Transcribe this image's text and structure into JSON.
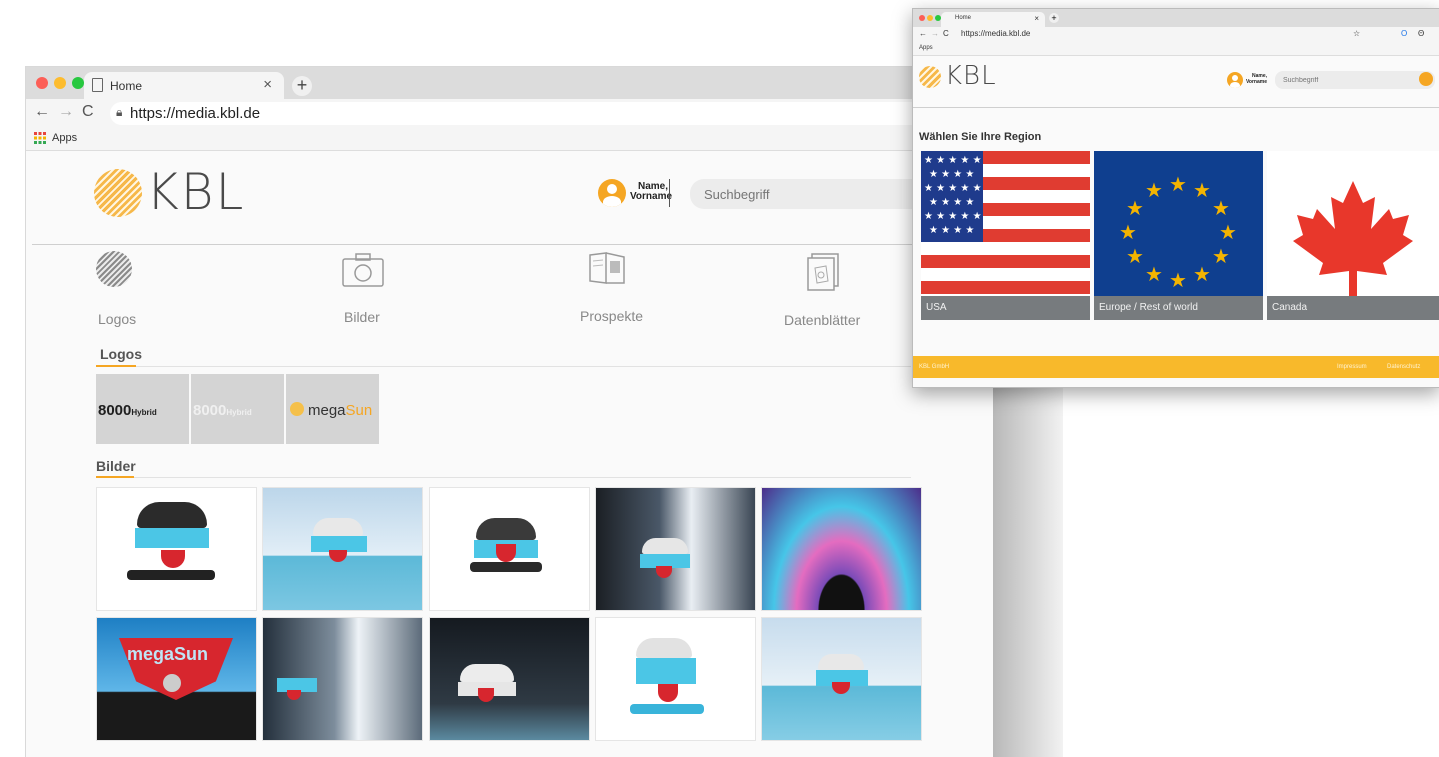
{
  "browser_main": {
    "tab_title": "Home",
    "new_tab": "+",
    "close_tab": "×",
    "url": "https://media.kbl.de",
    "bookmarks_label": "Apps"
  },
  "header": {
    "logo_text": "KBL",
    "user_name": "Name,",
    "user_first": "Vorname",
    "search_placeholder": "Suchbegriff"
  },
  "categories": [
    {
      "label": "Logos",
      "icon": "stripe-ball-icon"
    },
    {
      "label": "Bilder",
      "icon": "camera-icon"
    },
    {
      "label": "Prospekte",
      "icon": "brochure-icon"
    },
    {
      "label": "Datenblätter",
      "icon": "datasheet-icon"
    }
  ],
  "sections": {
    "logos_title": "Logos",
    "bilder_title": "Bilder"
  },
  "logo_tiles": [
    {
      "text": "8000",
      "suffix": "Hybrid"
    },
    {
      "text": "8000",
      "suffix": "Hybrid"
    },
    {
      "text": "mega",
      "suffix": "Sun"
    }
  ],
  "image_overlay_text": "megaSun",
  "region_window": {
    "tab_title": "Home",
    "url": "https://media.kbl.de",
    "bookmarks_label": "Apps",
    "logo_text": "KBL",
    "user_name": "Name,",
    "user_first": "Vorname",
    "search_placeholder": "Suchbegriff",
    "heading": "Wählen Sie Ihre Region",
    "regions": [
      "USA",
      "Europe / Rest of world",
      "Canada"
    ],
    "footer_left": "KBL GmbH",
    "footer_right_1": "Impressum",
    "footer_right_2": "Datenschutz"
  },
  "colors": {
    "accent": "#f5a623",
    "footer": "#f8b92b",
    "usa_red": "#e03c31",
    "usa_blue": "#1f3b8c",
    "eu_blue": "#0f3f8f",
    "eu_star": "#f4b400",
    "canada_red": "#e8372b"
  }
}
